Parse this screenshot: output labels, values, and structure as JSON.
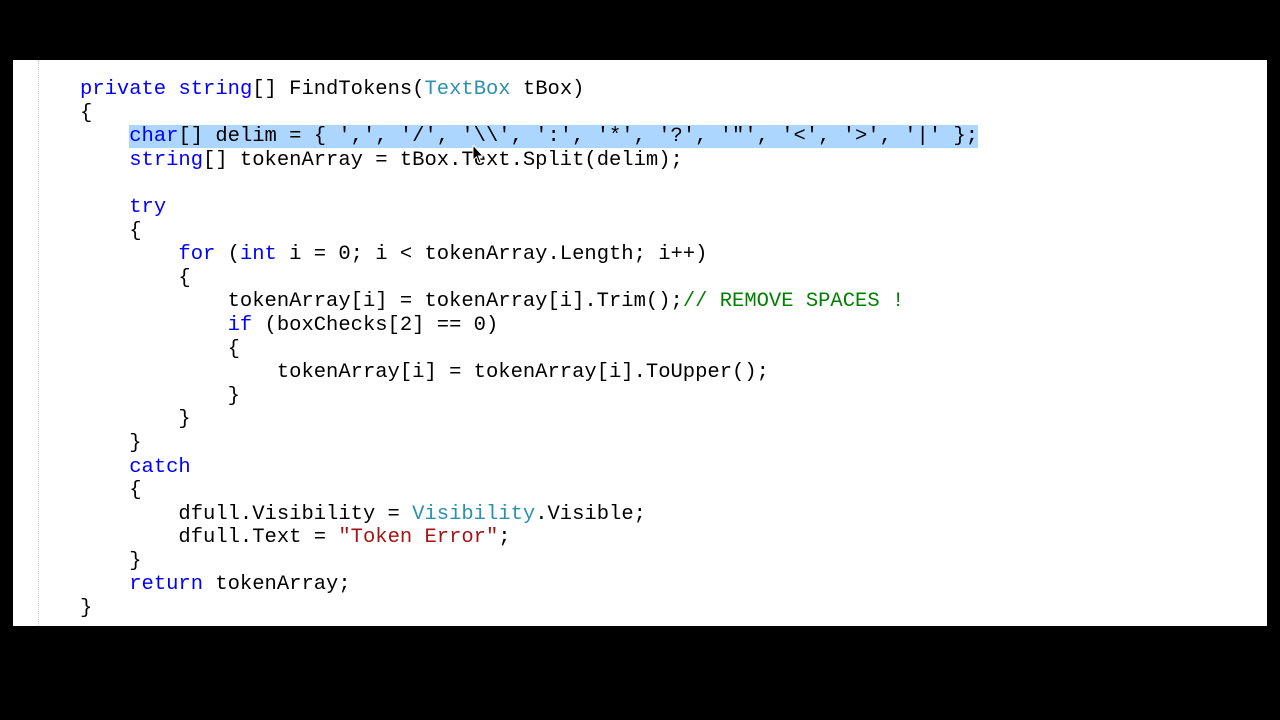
{
  "code": {
    "line1": {
      "kw_private": "private",
      "kw_string": "string",
      "brackets_fn": "[] FindTokens(",
      "type_textbox": "TextBox",
      "param_close": " tBox)"
    },
    "line2": "{",
    "line3_highlight": {
      "kw_char": "char",
      "rest": "[] delim = { ',', '/', '\\\\', ':', '*', '?', '\"', '<', '>', '|' };"
    },
    "line4": {
      "kw_string": "string",
      "rest": "[] tokenArray = tBox.Text.Split(delim);"
    },
    "line6": {
      "kw_try": "try"
    },
    "line7": "{",
    "line8": {
      "kw_for": "for",
      "open": " (",
      "kw_int": "int",
      "rest": " i = 0; i < tokenArray.Length; i++)"
    },
    "line9": "{",
    "line10": {
      "code": "tokenArray[i] = tokenArray[i].Trim();",
      "comment": "// REMOVE SPACES !"
    },
    "line11": {
      "kw_if": "if",
      "rest": " (boxChecks[2] == 0)"
    },
    "line12": "{",
    "line13": "tokenArray[i] = tokenArray[i].ToUpper();",
    "line14": "}",
    "line15": "}",
    "line16": "}",
    "line17": {
      "kw_catch": "catch"
    },
    "line18": "{",
    "line19": {
      "pre": "dfull.Visibility = ",
      "type_visibility": "Visibility",
      "post": ".Visible;"
    },
    "line20": {
      "pre": "dfull.Text = ",
      "str": "\"Token Error\"",
      "post": ";"
    },
    "line21": "}",
    "line22": {
      "kw_return": "return",
      "rest": " tokenArray;"
    },
    "line23": "}"
  }
}
